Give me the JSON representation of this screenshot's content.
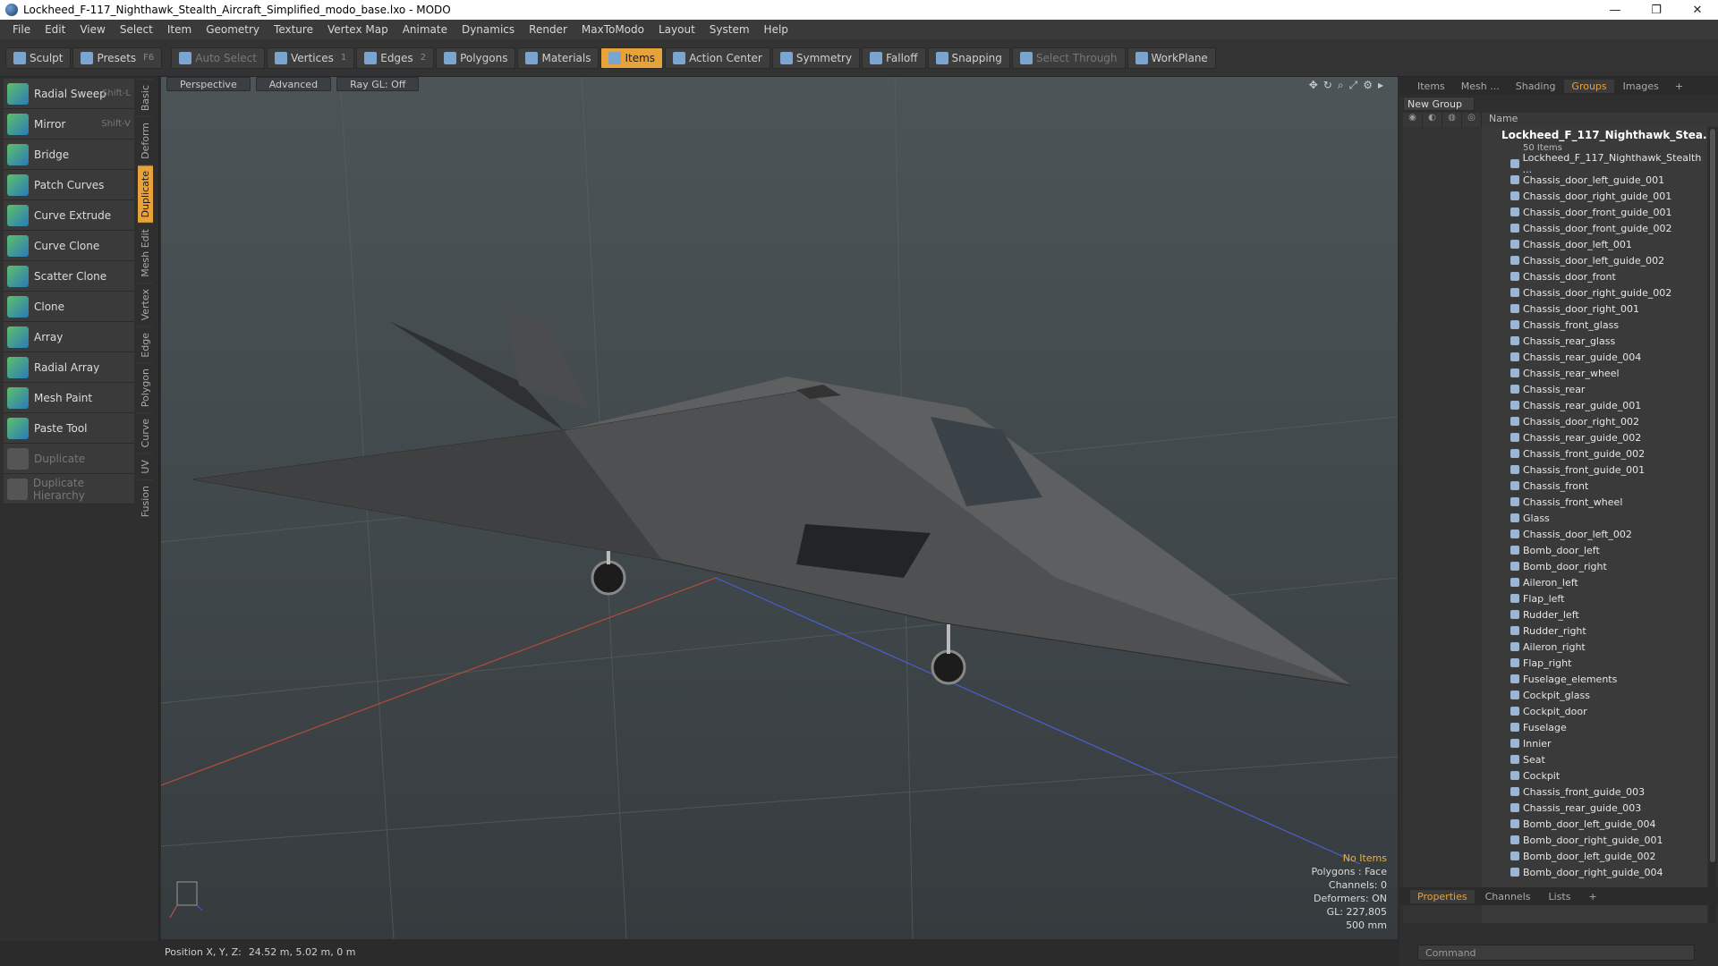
{
  "window": {
    "title": "Lockheed_F-117_Nighthawk_Stealth_Aircraft_Simplified_modo_base.lxo - MODO",
    "minimize": "—",
    "restore": "❐",
    "close": "✕"
  },
  "menu": [
    "File",
    "Edit",
    "View",
    "Select",
    "Item",
    "Geometry",
    "Texture",
    "Vertex Map",
    "Animate",
    "Dynamics",
    "Render",
    "MaxToModo",
    "Layout",
    "System",
    "Help"
  ],
  "toolbar": {
    "sculpt": "Sculpt",
    "presets": "Presets",
    "presets_key": "F6",
    "auto_select": "Auto Select",
    "vertices": "Vertices",
    "vertices_count": "1",
    "edges": "Edges",
    "edges_count": "2",
    "polygons": "Polygons",
    "materials": "Materials",
    "items": "Items",
    "action_center": "Action Center",
    "symmetry": "Symmetry",
    "falloff": "Falloff",
    "snapping": "Snapping",
    "select_through": "Select Through",
    "workplane": "WorkPlane"
  },
  "tools": [
    {
      "label": "Radial Sweep",
      "shortcut": "Shift-L"
    },
    {
      "label": "Mirror",
      "shortcut": "Shift-V"
    },
    {
      "label": "Bridge",
      "shortcut": ""
    },
    {
      "label": "Patch Curves",
      "shortcut": ""
    },
    {
      "label": "Curve Extrude",
      "shortcut": ""
    },
    {
      "label": "Curve Clone",
      "shortcut": ""
    },
    {
      "label": "Scatter Clone",
      "shortcut": ""
    },
    {
      "label": "Clone",
      "shortcut": ""
    },
    {
      "label": "Array",
      "shortcut": ""
    },
    {
      "label": "Radial Array",
      "shortcut": ""
    },
    {
      "label": "Mesh Paint",
      "shortcut": ""
    },
    {
      "label": "Paste Tool",
      "shortcut": ""
    },
    {
      "label": "Duplicate",
      "shortcut": ""
    },
    {
      "label": "Duplicate Hierarchy",
      "shortcut": ""
    }
  ],
  "vtabs": [
    "Basic",
    "Deform",
    "Duplicate",
    "Mesh Edit",
    "Vertex",
    "Edge",
    "Polygon",
    "Curve",
    "UV",
    "Fusion"
  ],
  "viewport": {
    "perspective": "Perspective",
    "advanced": "Advanced",
    "raygl": "Ray GL: Off",
    "info": {
      "no_items": "No Items",
      "polygons": "Polygons : Face",
      "channels": "Channels: 0",
      "deformers": "Deformers: ON",
      "gl": "GL: 227,805",
      "scale": "500 mm"
    }
  },
  "status": {
    "label": "Position X, Y, Z:",
    "value": "24.52 m, 5.02 m, 0 m"
  },
  "right_panel": {
    "tabs": [
      "Items",
      "Mesh ...",
      "Shading",
      "Groups",
      "Images"
    ],
    "new_group": "New Group",
    "name_header": "Name",
    "root": "Lockheed_F_117_Nighthawk_Stea...",
    "root_sub": "50 Items",
    "items": [
      "Lockheed_F_117_Nighthawk_Stealth ...",
      "Chassis_door_left_guide_001",
      "Chassis_door_right_guide_001",
      "Chassis_door_front_guide_001",
      "Chassis_door_front_guide_002",
      "Chassis_door_left_001",
      "Chassis_door_left_guide_002",
      "Chassis_door_front",
      "Chassis_door_right_guide_002",
      "Chassis_door_right_001",
      "Chassis_front_glass",
      "Chassis_rear_glass",
      "Chassis_rear_guide_004",
      "Chassis_rear_wheel",
      "Chassis_rear",
      "Chassis_rear_guide_001",
      "Chassis_door_right_002",
      "Chassis_rear_guide_002",
      "Chassis_front_guide_002",
      "Chassis_front_guide_001",
      "Chassis_front",
      "Chassis_front_wheel",
      "Glass",
      "Chassis_door_left_002",
      "Bomb_door_left",
      "Bomb_door_right",
      "Aileron_left",
      "Flap_left",
      "Rudder_left",
      "Rudder_right",
      "Aileron_right",
      "Flap_right",
      "Fuselage_elements",
      "Cockpit_glass",
      "Cockpit_door",
      "Fuselage",
      "Innier",
      "Seat",
      "Cockpit",
      "Chassis_front_guide_003",
      "Chassis_rear_guide_003",
      "Bomb_door_left_guide_004",
      "Bomb_door_right_guide_001",
      "Bomb_door_left_guide_002",
      "Bomb_door_right_guide_004"
    ],
    "bottom_tabs": [
      "Properties",
      "Channels",
      "Lists"
    ],
    "command_placeholder": "Command"
  }
}
